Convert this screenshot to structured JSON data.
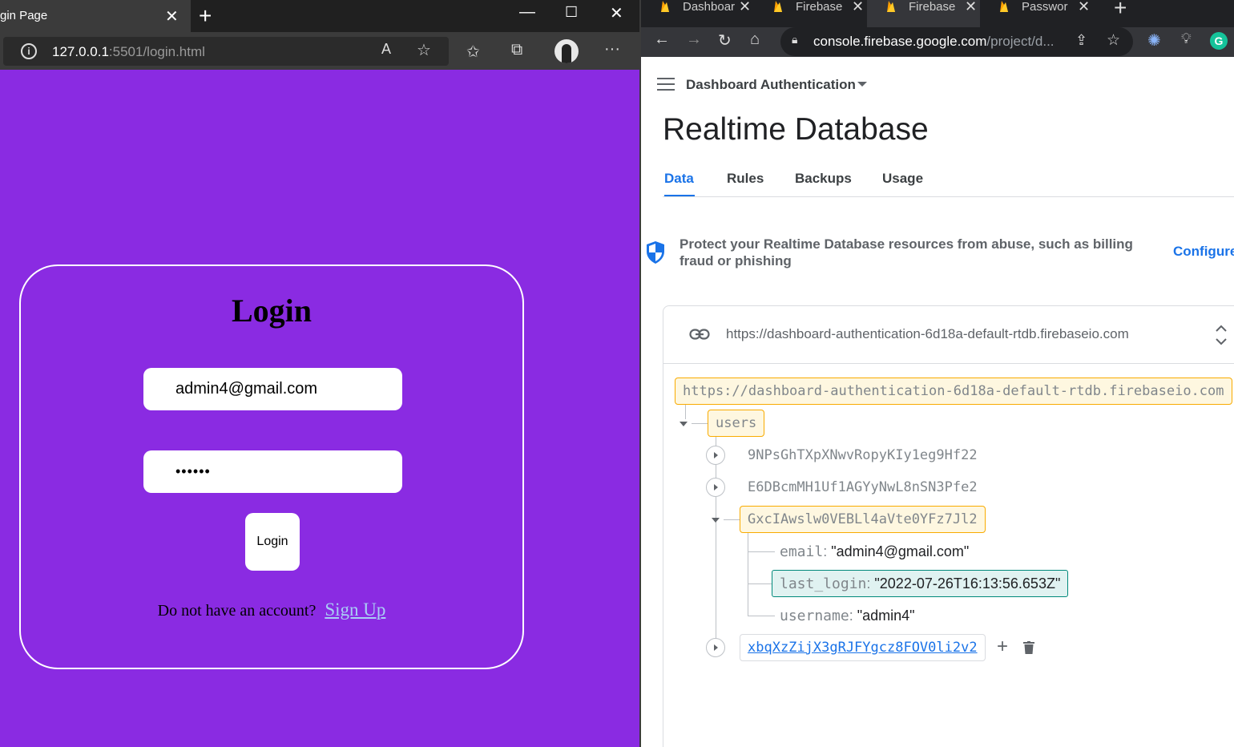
{
  "left_browser": {
    "tab_title": "gin Page",
    "url_host": "127.0.0.1",
    "url_rest": ":5501/login.html"
  },
  "login_page": {
    "heading": "Login",
    "email_value": "admin4@gmail.com",
    "password_value": "••••••",
    "login_button": "Login",
    "signup_prompt": "Do not have an account?",
    "signup_link": "Sign Up",
    "background_color": "#8a2be2"
  },
  "right_browser": {
    "tabs": [
      {
        "label": "Dashboar"
      },
      {
        "label": "Firebase"
      },
      {
        "label": "Firebase"
      },
      {
        "label": "Passwor"
      }
    ],
    "url_host": "console.firebase.google.com",
    "url_rest": "/project/d..."
  },
  "firebase": {
    "project": "Dashboard Authentication",
    "title": "Realtime Database",
    "tabs": [
      "Data",
      "Rules",
      "Backups",
      "Usage"
    ],
    "banner": "Protect your Realtime Database resources from abuse, such as billing fraud or phishing",
    "configure": "Configure",
    "db_url": "https://dashboard-authentication-6d18a-default-rtdb.firebaseio.com",
    "root_node": "https://dashboard-authentication-6d18a-default-rtdb.firebaseio.com",
    "users_node": "users",
    "user_keys": [
      "9NPsGhTXpXNwvRopyKIy1eg9Hf22",
      "E6DBcmMH1Uf1AGYyNwL8nSN3Pfe2",
      "GxcIAwslw0VEBLl4aVte0YFz7Jl2",
      "xbqXzZijX3gRJFYgcz8FOV0li2v2"
    ],
    "fields": [
      {
        "key": "email",
        "value": "\"admin4@gmail.com\""
      },
      {
        "key": "last_login",
        "value": "\"2022-07-26T16:13:56.653Z\""
      },
      {
        "key": "username",
        "value": "\"admin4\""
      }
    ]
  }
}
